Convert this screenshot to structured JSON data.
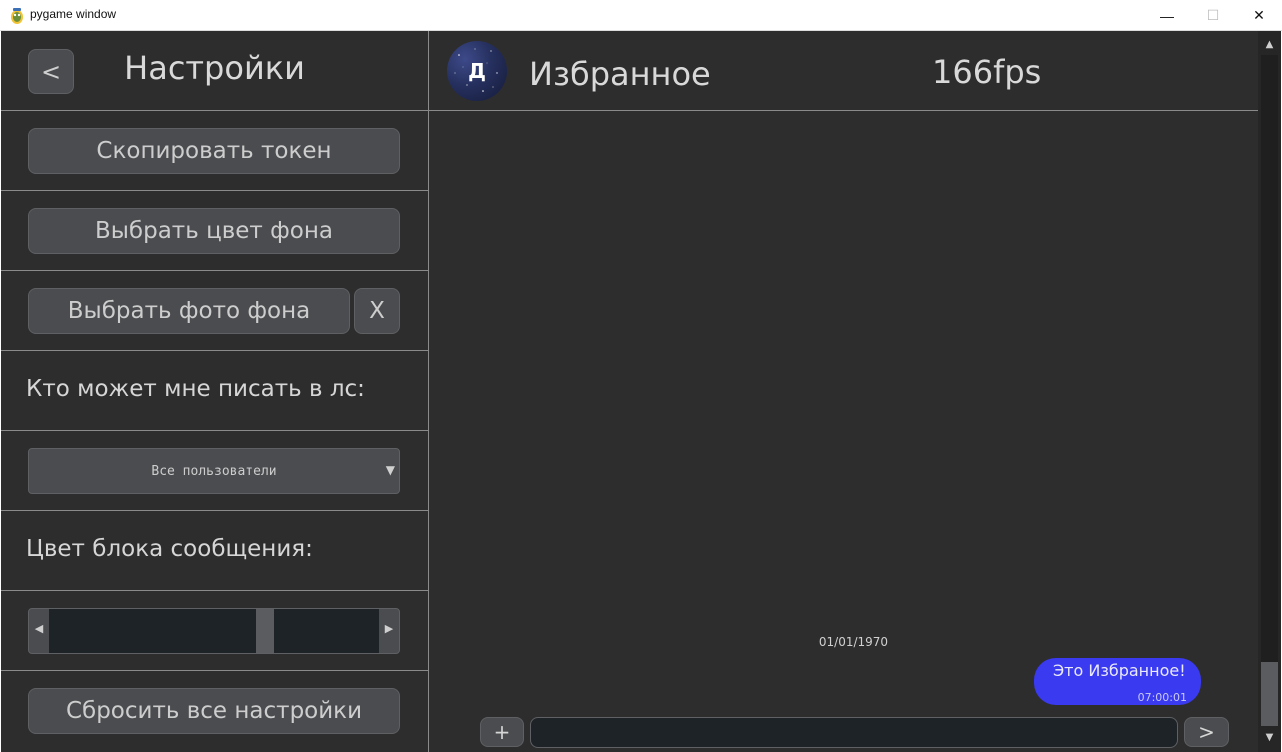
{
  "window": {
    "title": "pygame window",
    "minimize_glyph": "—",
    "maximize_glyph": "☐",
    "close_glyph": "✕"
  },
  "sidebar": {
    "back_label": "<",
    "title": "Настройки",
    "copy_token_label": "Скопировать токен",
    "choose_bg_color_label": "Выбрать цвет фона",
    "choose_bg_photo_label": "Выбрать фото фона",
    "clear_bg_photo_label": "X",
    "dm_label": "Кто может мне писать в лс:",
    "dm_dropdown": {
      "selected": "Все пользователи",
      "arrow": "▼"
    },
    "message_color_label": "Цвет блока сообщения:",
    "message_color_slider": {
      "left_arrow": "◀",
      "right_arrow": "▶",
      "value_fraction": 0.7
    },
    "reset_label": "Сбросить все настройки"
  },
  "chat": {
    "avatar_letter": "Д",
    "name": "Избранное",
    "fps": "166fps",
    "date_separator": "01/01/1970",
    "messages": [
      {
        "text": "Это Избранное!",
        "time": "07:00:01"
      }
    ],
    "attach_label": "+",
    "send_label": ">",
    "input_value": ""
  },
  "scrollbar": {
    "up": "▲",
    "down": "▼"
  },
  "colors": {
    "background": "#2d2d2d",
    "button": "#4a4c4f",
    "divider": "#8a8a8a",
    "bubble": "#3a3af0",
    "input": "#1e2328"
  },
  "icons": {
    "app": "pygame-snake-icon"
  }
}
